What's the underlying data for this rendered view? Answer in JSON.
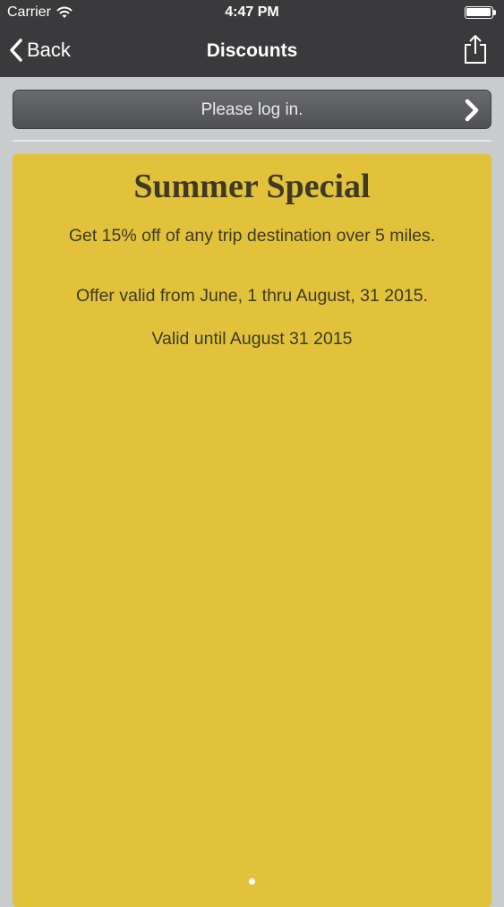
{
  "status_bar": {
    "carrier": "Carrier",
    "time": "4:47 PM"
  },
  "nav": {
    "back_label": "Back",
    "title": "Discounts"
  },
  "login": {
    "label": "Please log in."
  },
  "offer": {
    "title": "Summer Special",
    "description": "Get 15% off of any trip destination over 5 miles.",
    "validity_range": "Offer valid from June, 1 thru August, 31 2015.",
    "valid_until": "Valid until August 31 2015"
  },
  "pager": {
    "current_page": 1,
    "total_pages": 1
  },
  "colors": {
    "bar_background": "#3a3a3c",
    "card_background": "#e1c23a",
    "card_text": "#3f3a25"
  }
}
